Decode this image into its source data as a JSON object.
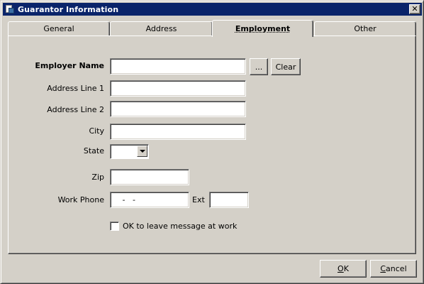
{
  "window": {
    "title": "Guarantor Information",
    "close_glyph": "✕"
  },
  "tabs": [
    {
      "label": "General",
      "active": false
    },
    {
      "label": "Address",
      "active": false
    },
    {
      "label": "Employment",
      "active": true
    },
    {
      "label": "Other",
      "active": false
    }
  ],
  "form": {
    "employer_name": {
      "label": "Employer Name",
      "value": ""
    },
    "browse_button": "...",
    "clear_button": "Clear",
    "address_line_1": {
      "label": "Address Line 1",
      "value": ""
    },
    "address_line_2": {
      "label": "Address Line 2",
      "value": ""
    },
    "city": {
      "label": "City",
      "value": ""
    },
    "state": {
      "label": "State",
      "value": ""
    },
    "zip": {
      "label": "Zip",
      "value": ""
    },
    "work_phone": {
      "label": "Work Phone",
      "value": "   -   -"
    },
    "ext": {
      "label": "Ext",
      "value": ""
    },
    "message_checkbox": {
      "label": "OK to leave message at work",
      "checked": false
    }
  },
  "footer": {
    "ok": {
      "mnemonic": "O",
      "rest": "K"
    },
    "cancel": {
      "mnemonic": "C",
      "rest": "ancel"
    }
  },
  "icons": {
    "window": "window-icon",
    "dropdown": "chevron-down-icon"
  }
}
